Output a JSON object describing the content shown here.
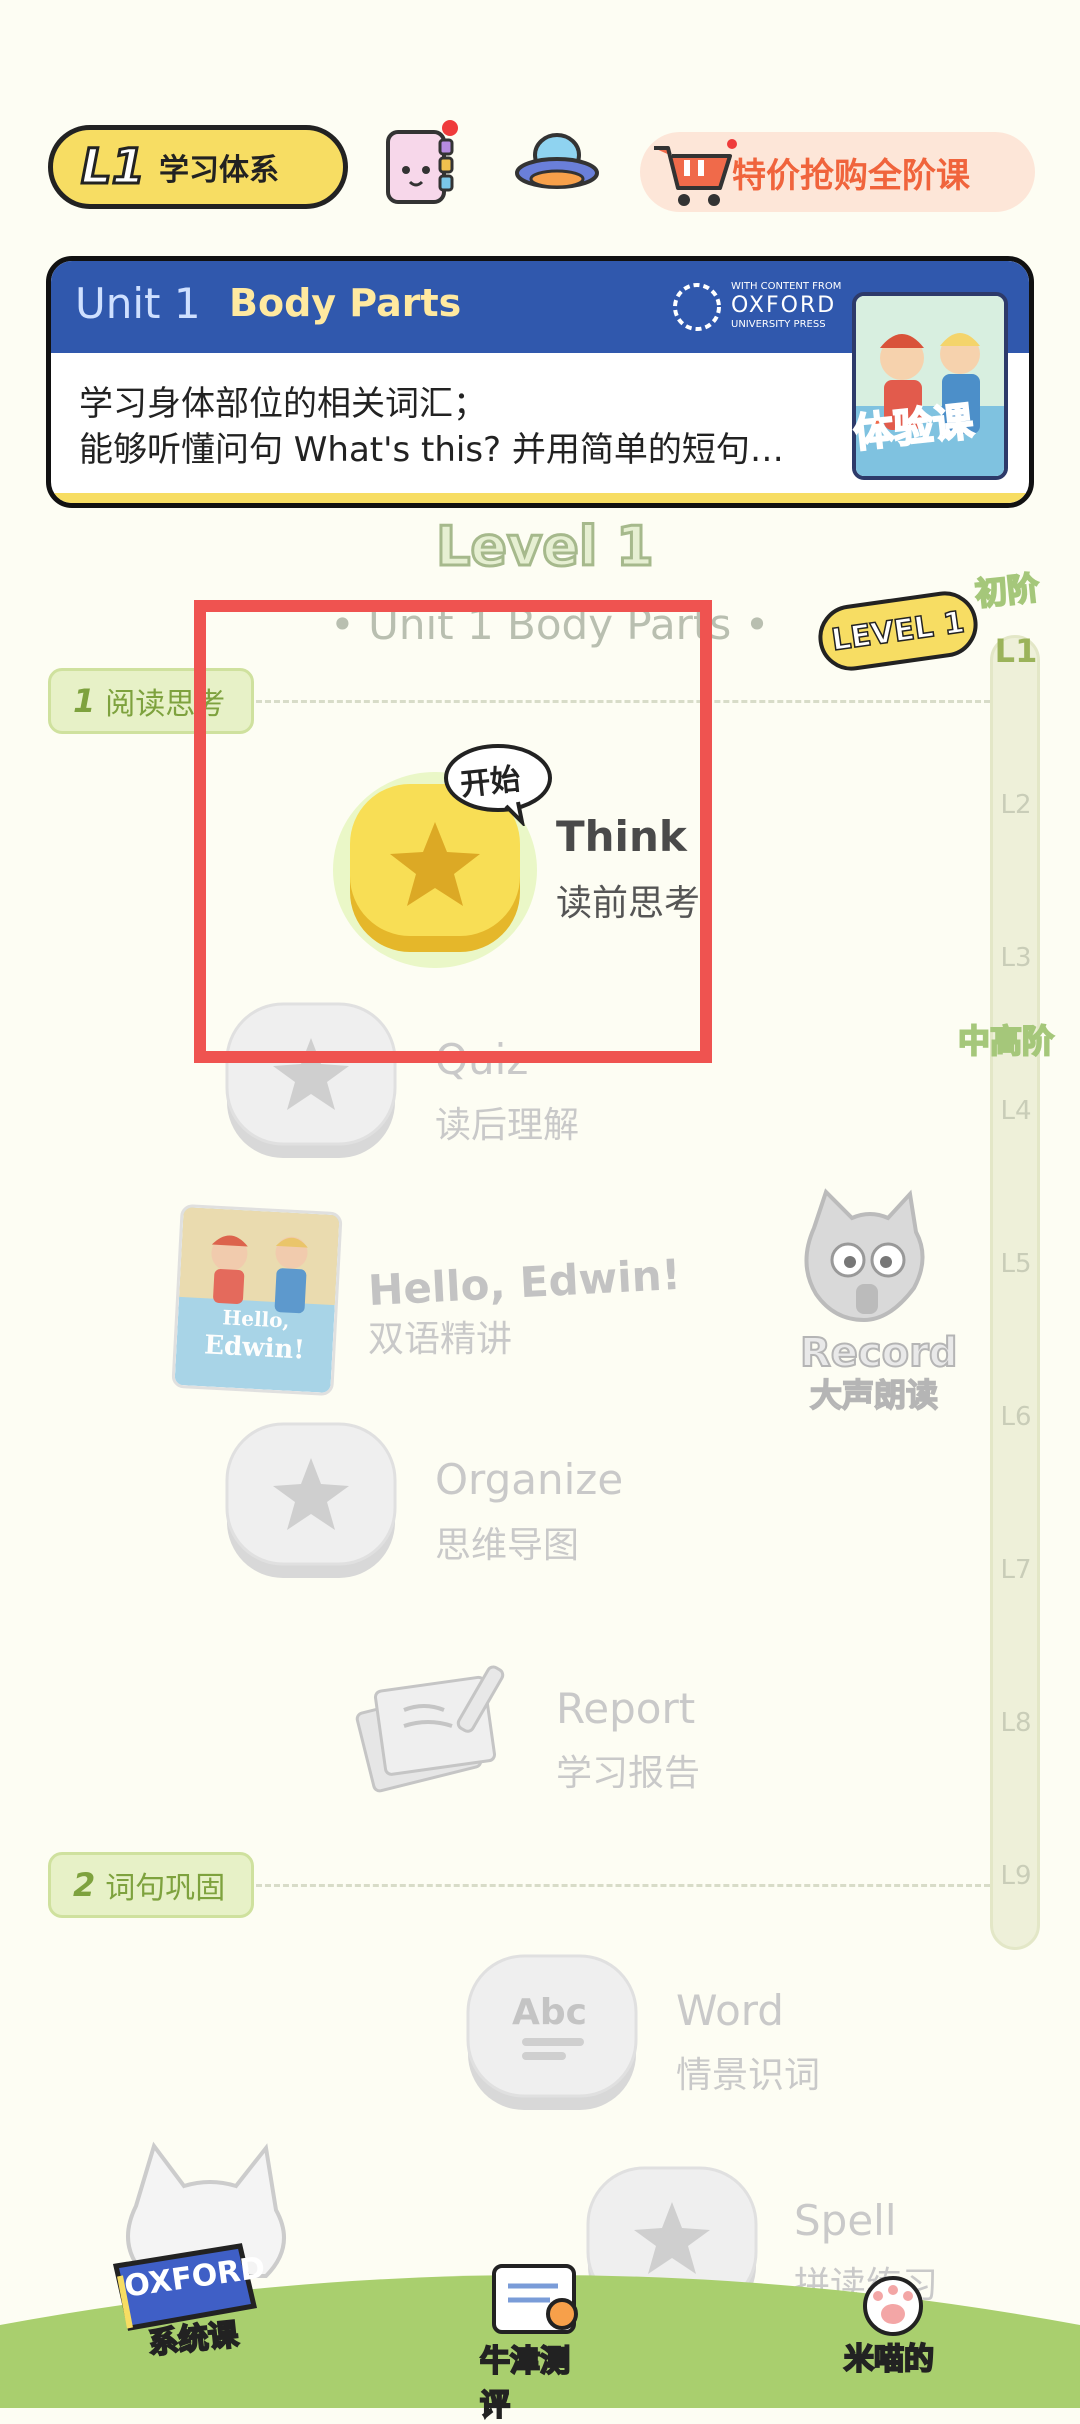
{
  "topbar": {
    "level_badge": "L1",
    "system_label": "学习体系",
    "shop_label": "特价抢购全阶课"
  },
  "unit_card": {
    "unit_label": "Unit 1",
    "unit_title": "Body Parts",
    "publisher_small": "WITH CONTENT FROM",
    "publisher_name": "OXFORD",
    "publisher_sub": "UNIVERSITY PRESS",
    "desc_line1": "学习身体部位的相关词汇；",
    "desc_line2": "能够听懂问句 What's this? 并用简单的短句…",
    "trial_label": "体验课"
  },
  "level_title": "Level 1",
  "unit_subtitle": "• Unit 1  Body Parts •",
  "rail": {
    "current_badge": "LEVEL 1",
    "stage_beginner": "初阶",
    "stage_mid": "中高阶",
    "levels": [
      "L1",
      "L2",
      "L3",
      "L4",
      "L5",
      "L6",
      "L7",
      "L8",
      "L9"
    ]
  },
  "sections": [
    {
      "num": "1",
      "label": "阅读思考"
    },
    {
      "num": "2",
      "label": "词句巩固"
    }
  ],
  "steps": {
    "think": {
      "title": "Think",
      "subtitle": "读前思考",
      "bubble": "开始"
    },
    "quiz": {
      "title": "Quiz",
      "subtitle": "读后理解"
    },
    "book": {
      "title": "Hello, Edwin!",
      "subtitle": "双语精讲",
      "cover_line1": "Hello,",
      "cover_line2": "Edwin!"
    },
    "record": {
      "title": "Record",
      "subtitle": "大声朗读"
    },
    "organize": {
      "title": "Organize",
      "subtitle": "思维导图"
    },
    "report": {
      "title": "Report",
      "subtitle": "学习报告"
    },
    "word": {
      "title": "Word",
      "subtitle": "情景识词",
      "icon_text": "Abc"
    },
    "spell": {
      "title": "Spell",
      "subtitle": "拼读练习"
    }
  },
  "bottom_nav": {
    "oxford_label": "OXFORD",
    "system_course": "系统课",
    "oxford_test": "牛津测评",
    "mine": "米喵的"
  },
  "colors": {
    "accent_yellow": "#f7dd63",
    "header_blue": "#3058ad",
    "highlight_red": "#ef5350",
    "green": "#9bb35a"
  }
}
